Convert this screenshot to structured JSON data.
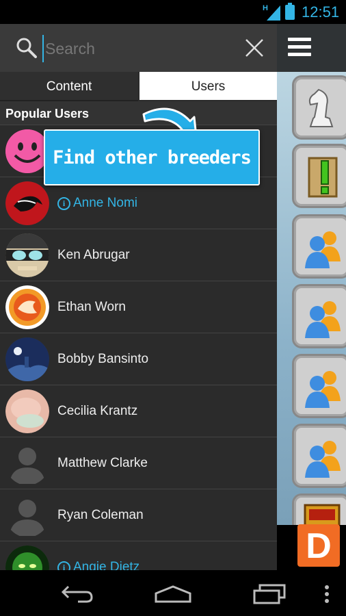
{
  "status_bar": {
    "network": "H",
    "time": "12:51"
  },
  "search": {
    "placeholder": "Search",
    "value": ""
  },
  "tabs": [
    {
      "label": "Content"
    },
    {
      "label": "Users"
    }
  ],
  "section": {
    "title": "Popular Users"
  },
  "tooltip": {
    "text": "Find other breeders"
  },
  "users": [
    {
      "name": "",
      "avatar": "pink-smiley",
      "verified": false
    },
    {
      "name": "Anne Nomi",
      "avatar": "red-horse",
      "verified": true
    },
    {
      "name": "Ken Abrugar",
      "avatar": "ninja",
      "verified": false
    },
    {
      "name": "Ethan Worn",
      "avatar": "white-dragon",
      "verified": false
    },
    {
      "name": "Bobby Bansinto",
      "avatar": "night-scene",
      "verified": false
    },
    {
      "name": "Cecilia Krantz",
      "avatar": "pink-photo",
      "verified": false
    },
    {
      "name": "Matthew Clarke",
      "avatar": "default-person",
      "verified": false
    },
    {
      "name": "Ryan Coleman",
      "avatar": "default-person",
      "verified": false
    },
    {
      "name": "Angie Dietz",
      "avatar": "green-monster",
      "verified": true
    }
  ],
  "right_panel": {
    "buttons": [
      "chess-knight-icon",
      "quest-scroll-icon",
      "friends-icon",
      "friends-icon",
      "friends-icon",
      "friends-icon",
      "treasure-icon"
    ],
    "badge": "D"
  },
  "colors": {
    "accent": "#33b5e5",
    "tooltip": "#25aee8",
    "badge": "#f16c24"
  }
}
